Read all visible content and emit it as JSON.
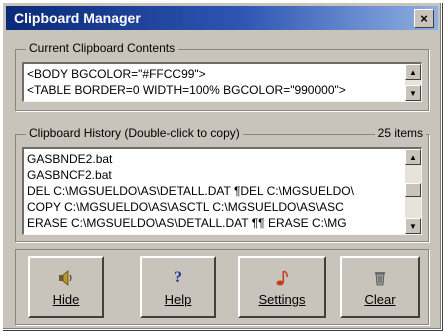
{
  "window": {
    "title": "Clipboard Manager",
    "close_label": "×"
  },
  "current": {
    "label": "Current Clipboard Contents",
    "lines": [
      "<BODY BGCOLOR=\"#FFCC99\">",
      "<TABLE BORDER=0 WIDTH=100% BGCOLOR=\"990000\">"
    ]
  },
  "history": {
    "label": "Clipboard History  (Double-click to copy)",
    "count": "25 items",
    "items": [
      "GASBNDE2.bat",
      "GASBNCF2.bat",
      "DEL C:\\MGSUELDO\\AS\\DETALL.DAT ¶DEL C:\\MGSUELDO\\",
      "COPY C:\\MGSUELDO\\AS\\ASCTL      C:\\MGSUELDO\\AS\\ASC",
      "ERASE  C:\\MGSUELDO\\AS\\DETALL.DAT ¶¶   ERASE  C:\\MG"
    ]
  },
  "buttons": {
    "hide": "Hide",
    "help": "Help",
    "settings": "Settings",
    "clear": "Clear"
  },
  "icons": {
    "hide": "speaker-icon",
    "help": "question-icon",
    "settings": "music-note-icon",
    "clear": "trash-can-icon"
  },
  "colors": {
    "title_start": "#0a2a78",
    "title_end": "#8fb0e0",
    "face": "#c8c4bc"
  }
}
